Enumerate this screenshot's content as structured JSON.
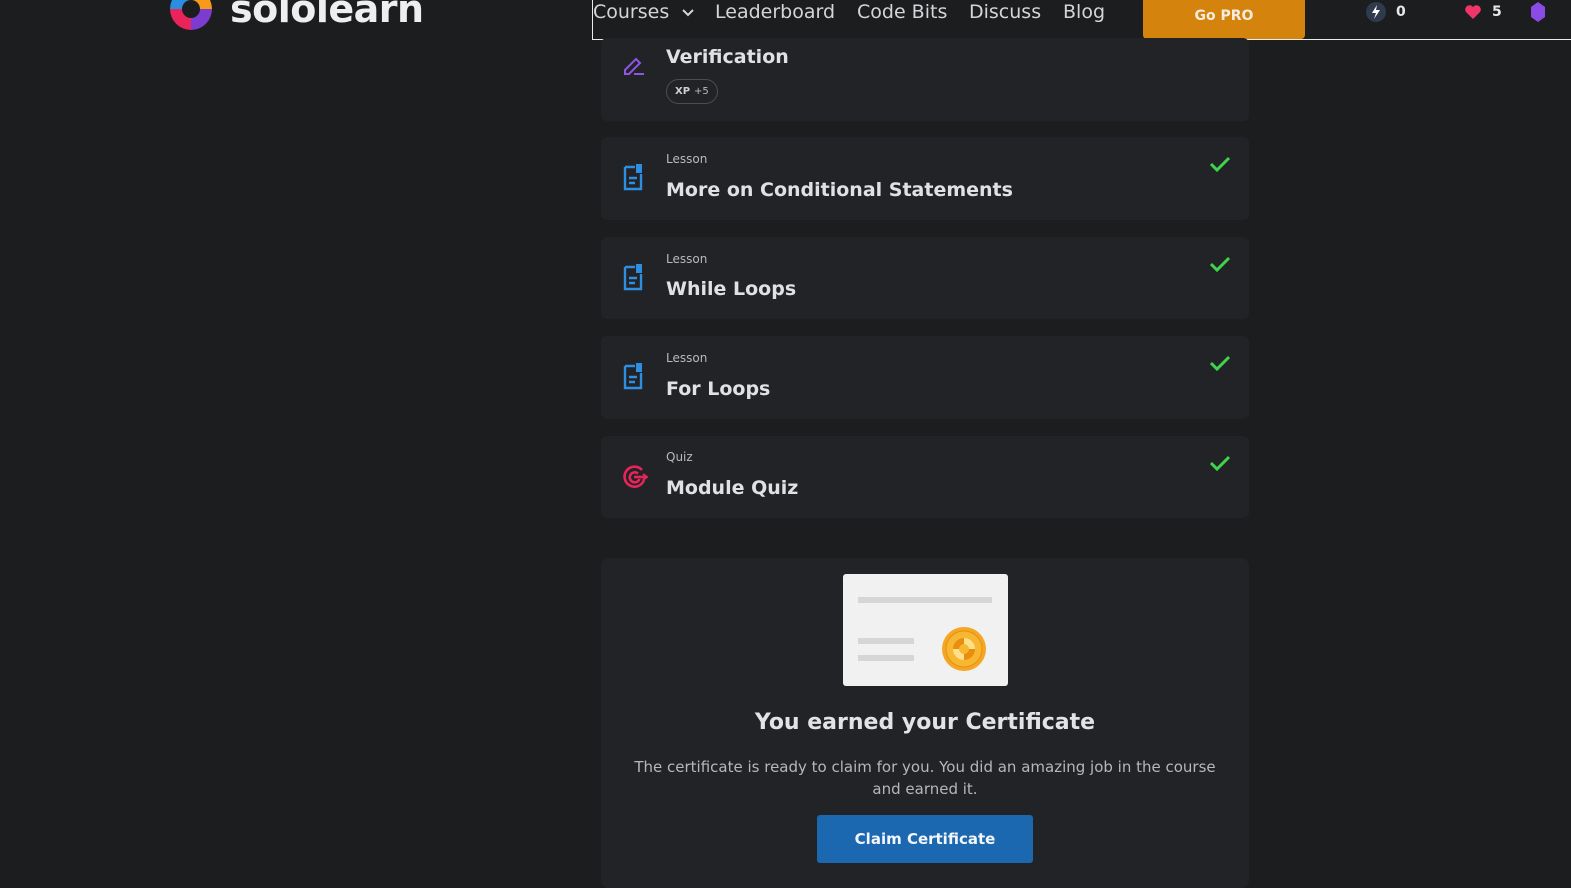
{
  "header": {
    "brand": "sololearn",
    "nav": [
      "Courses",
      "Leaderboard",
      "Code Bits",
      "Discuss",
      "Blog"
    ],
    "gopro_label": "Go PRO",
    "streak_count": "0",
    "hearts_count": "5"
  },
  "items": [
    {
      "kind": "",
      "title": "Verification",
      "xp_label": "XP",
      "xp_value": "+5",
      "icon": "pen-icon"
    },
    {
      "kind": "Lesson",
      "title": "More on Conditional Statements",
      "icon": "lesson-icon",
      "completed": true
    },
    {
      "kind": "Lesson",
      "title": "While Loops",
      "icon": "lesson-icon",
      "completed": true
    },
    {
      "kind": "Lesson",
      "title": "For Loops",
      "icon": "lesson-icon",
      "completed": true
    },
    {
      "kind": "Quiz",
      "title": "Module Quiz",
      "icon": "quiz-target-icon",
      "completed": true
    }
  ],
  "certificate": {
    "heading": "You earned your Certificate",
    "text": "The certificate is ready to claim for you. You did an amazing job in the course and earned it.",
    "button_label": "Claim Certificate"
  },
  "colors": {
    "background": "#1c1d1f",
    "card": "#222326",
    "accent_blue": "#1c68b0",
    "gopro": "#d4830c",
    "check_green": "#3fd44b"
  }
}
